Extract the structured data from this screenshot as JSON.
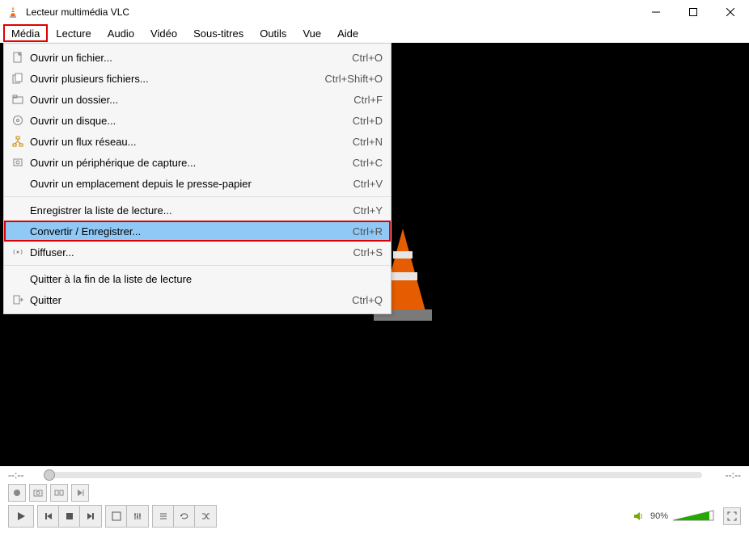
{
  "window": {
    "title": "Lecteur multimédia VLC"
  },
  "menubar": {
    "items": [
      {
        "label": "Média",
        "highlighted": true
      },
      {
        "label": "Lecture"
      },
      {
        "label": "Audio"
      },
      {
        "label": "Vidéo"
      },
      {
        "label": "Sous-titres"
      },
      {
        "label": "Outils"
      },
      {
        "label": "Vue"
      },
      {
        "label": "Aide"
      }
    ]
  },
  "dropdown": {
    "items": [
      {
        "icon": "file",
        "label": "Ouvrir un fichier...",
        "shortcut": "Ctrl+O"
      },
      {
        "icon": "files",
        "label": "Ouvrir plusieurs fichiers...",
        "shortcut": "Ctrl+Shift+O"
      },
      {
        "icon": "folder",
        "label": "Ouvrir un dossier...",
        "shortcut": "Ctrl+F"
      },
      {
        "icon": "disc",
        "label": "Ouvrir un disque...",
        "shortcut": "Ctrl+D"
      },
      {
        "icon": "network",
        "label": "Ouvrir un flux réseau...",
        "shortcut": "Ctrl+N"
      },
      {
        "icon": "capture",
        "label": "Ouvrir un périphérique de capture...",
        "shortcut": "Ctrl+C"
      },
      {
        "icon": "",
        "label": "Ouvrir un emplacement depuis le presse-papier",
        "shortcut": "Ctrl+V"
      },
      {
        "sep": true
      },
      {
        "icon": "",
        "label": "Enregistrer la liste de lecture...",
        "shortcut": "Ctrl+Y"
      },
      {
        "icon": "",
        "label": "Convertir / Enregistrer...",
        "shortcut": "Ctrl+R",
        "selected": true,
        "redbox": true
      },
      {
        "icon": "stream",
        "label": "Diffuser...",
        "shortcut": "Ctrl+S"
      },
      {
        "sep": true
      },
      {
        "icon": "",
        "label": "Quitter à la fin de la liste de lecture",
        "shortcut": ""
      },
      {
        "icon": "quit",
        "label": "Quitter",
        "shortcut": "Ctrl+Q"
      }
    ]
  },
  "seek": {
    "left_time": "--:--",
    "right_time": "--:--"
  },
  "volume": {
    "percent": "90%",
    "level": 90
  }
}
